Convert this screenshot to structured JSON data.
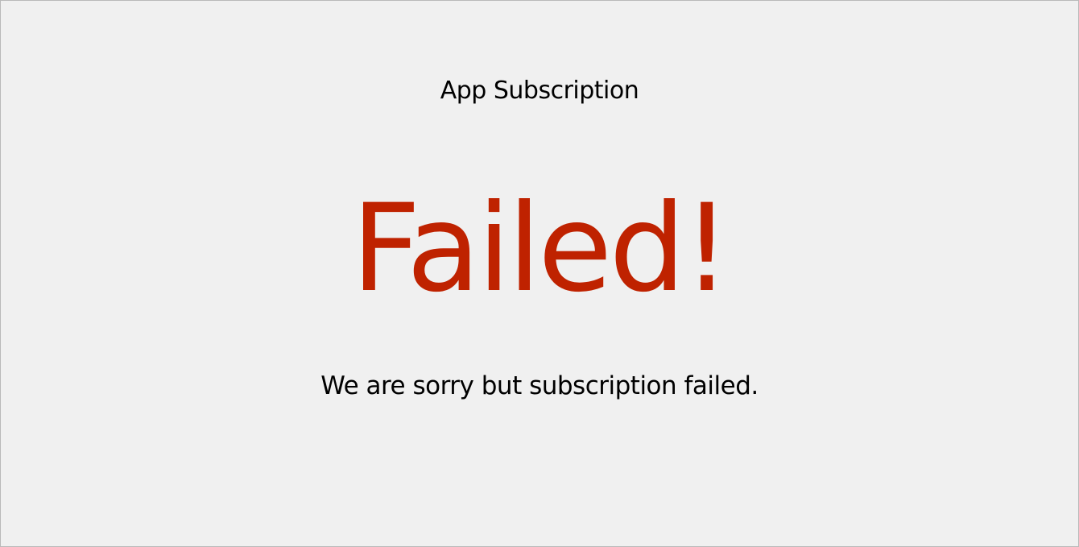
{
  "header": {
    "title": "App Subscription"
  },
  "status": {
    "heading": "Failed!",
    "message": "We are sorry but subscription failed.",
    "heading_color": "#bf2200",
    "background_color": "#f0f0f0"
  }
}
